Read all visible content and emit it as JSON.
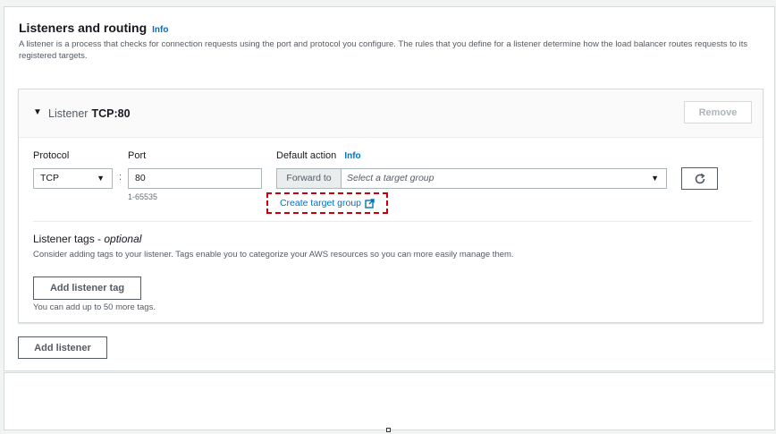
{
  "section": {
    "title": "Listeners and routing",
    "info": "Info",
    "description": "A listener is a process that checks for connection requests using the port and protocol you configure. The rules that you define for a listener determine how the load balancer routes requests to its registered targets."
  },
  "listener": {
    "label": "Listener",
    "name": "TCP:80",
    "remove": "Remove",
    "protocol_label": "Protocol",
    "protocol_value": "TCP",
    "port_label": "Port",
    "port_value": "80",
    "port_hint": "1-65535",
    "default_action_label": "Default action",
    "default_action_info": "Info",
    "forward_prefix": "Forward to",
    "target_placeholder": "Select a target group",
    "create_target_group": "Create target group",
    "tags_title": "Listener tags - ",
    "tags_optional": "optional",
    "tags_description": "Consider adding tags to your listener. Tags enable you to categorize your AWS resources so you can more easily manage them.",
    "add_tag": "Add listener tag",
    "tags_limit": "You can add up to 50 more tags."
  },
  "add_listener": "Add listener",
  "colors": {
    "link": "#0073bb",
    "highlight": "#c7000b",
    "border": "#aab7b8"
  }
}
